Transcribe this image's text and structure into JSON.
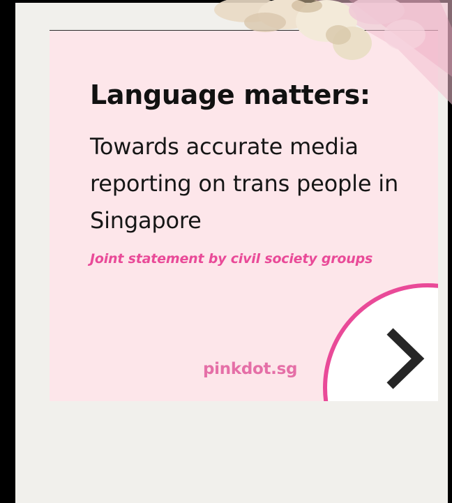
{
  "post": {
    "title": "Language matters:",
    "subtitle": "Towards accurate media reporting on trans people in Singapore",
    "tagline": "Joint statement by civil society groups",
    "logo_text": "pinkdot.sg"
  },
  "navigation": {
    "next_icon": "chevron-right-icon"
  },
  "colors": {
    "background": "#000000",
    "frame": "#f1f0ec",
    "card": "#fde6ea",
    "accent_pink": "#e94a98",
    "logo_pink": "#e56fa7",
    "text_dark": "#111111",
    "chevron": "#262626"
  }
}
